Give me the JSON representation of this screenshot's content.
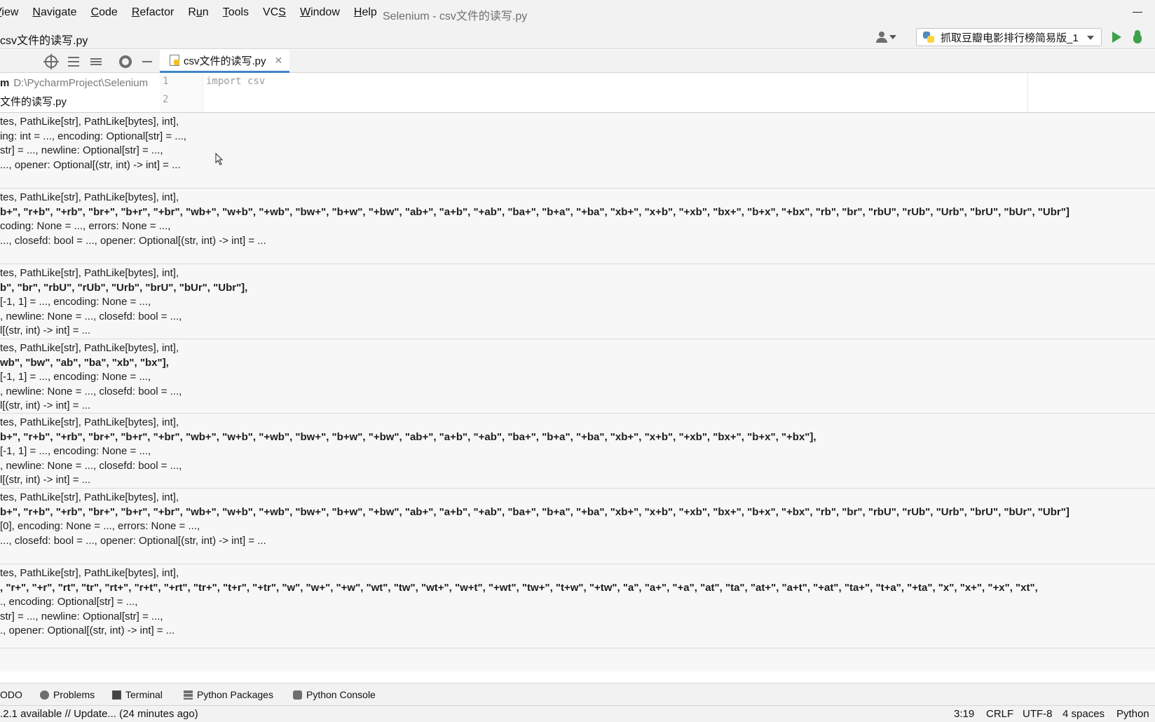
{
  "menu": {
    "items": [
      "View",
      "Navigate",
      "Code",
      "Refactor",
      "Run",
      "Tools",
      "VCS",
      "Window",
      "Help"
    ],
    "underlined": [
      "V",
      "N",
      "C",
      "R",
      "u",
      "T",
      "S",
      "W",
      "H"
    ],
    "rest": [
      "iew",
      "avigate",
      "ode",
      "efactor",
      "n",
      "ools",
      "VC",
      "indow",
      "elp"
    ]
  },
  "window_title": "Selenium - csv文件的读写.py",
  "breadcrumb": "csv文件的读写.py",
  "run_config": {
    "label": "抓取豆瓣电影排行榜简易版_1"
  },
  "editor_tab": {
    "label": "csv文件的读写.py"
  },
  "project_tree": {
    "root_name": "m",
    "root_path": "D:\\PycharmProject\\Selenium",
    "file": "文件的读写.py"
  },
  "editor": {
    "lines": [
      {
        "num": "1",
        "code": "import csv"
      },
      {
        "num": "2",
        "code": ""
      }
    ]
  },
  "param_info": {
    "blocks": [
      {
        "lines": [
          {
            "text": "tes, PathLike[str], PathLike[bytes], int],",
            "bold": false
          },
          {
            "text": "ing: int = ..., encoding: Optional[str] = ...,",
            "bold": false
          },
          {
            "text": "str] = ..., newline: Optional[str] = ...,",
            "bold": false
          },
          {
            "text": "..., opener: Optional[(str, int) -> int] = ...",
            "bold": false
          }
        ]
      },
      {
        "lines": [
          {
            "text": "tes, PathLike[str], PathLike[bytes], int],",
            "bold": false
          },
          {
            "text": "b+\", \"r+b\", \"+rb\", \"br+\", \"b+r\", \"+br\", \"wb+\", \"w+b\", \"+wb\", \"bw+\", \"b+w\", \"+bw\", \"ab+\", \"a+b\", \"+ab\", \"ba+\", \"b+a\", \"+ba\", \"xb+\", \"x+b\", \"+xb\", \"bx+\", \"b+x\", \"+bx\", \"rb\", \"br\", \"rbU\", \"rUb\", \"Urb\", \"brU\", \"bUr\", \"Ubr\"]",
            "bold": true
          },
          {
            "text": "coding: None = ..., errors: None = ...,",
            "bold": false
          },
          {
            "text": "..., closefd: bool = ..., opener: Optional[(str, int) -> int] = ...",
            "bold": false
          }
        ]
      },
      {
        "lines": [
          {
            "text": "tes, PathLike[str], PathLike[bytes], int],",
            "bold": false
          },
          {
            "text": "b\", \"br\", \"rbU\", \"rUb\", \"Urb\", \"brU\", \"bUr\", \"Ubr\"],",
            "bold": true
          },
          {
            "text": "[-1, 1] = ..., encoding: None = ...,",
            "bold": false
          },
          {
            "text": ", newline: None = ..., closefd: bool = ...,",
            "bold": false
          },
          {
            "text": "l[(str, int) -> int] = ...",
            "bold": false
          }
        ]
      },
      {
        "lines": [
          {
            "text": "tes, PathLike[str], PathLike[bytes], int],",
            "bold": false
          },
          {
            "text": "wb\", \"bw\", \"ab\", \"ba\", \"xb\", \"bx\"],",
            "bold": true
          },
          {
            "text": "[-1, 1] = ..., encoding: None = ...,",
            "bold": false
          },
          {
            "text": ", newline: None = ..., closefd: bool = ...,",
            "bold": false
          },
          {
            "text": "l[(str, int) -> int] = ...",
            "bold": false
          }
        ]
      },
      {
        "lines": [
          {
            "text": "tes, PathLike[str], PathLike[bytes], int],",
            "bold": false
          },
          {
            "text": "b+\", \"r+b\", \"+rb\", \"br+\", \"b+r\", \"+br\", \"wb+\", \"w+b\", \"+wb\", \"bw+\", \"b+w\", \"+bw\", \"ab+\", \"a+b\", \"+ab\", \"ba+\", \"b+a\", \"+ba\", \"xb+\", \"x+b\", \"+xb\", \"bx+\", \"b+x\", \"+bx\"],",
            "bold": true
          },
          {
            "text": "[-1, 1] = ..., encoding: None = ...,",
            "bold": false
          },
          {
            "text": ", newline: None = ..., closefd: bool = ...,",
            "bold": false
          },
          {
            "text": "l[(str, int) -> int] = ...",
            "bold": false
          }
        ]
      },
      {
        "lines": [
          {
            "text": "tes, PathLike[str], PathLike[bytes], int],",
            "bold": false
          },
          {
            "text": "b+\", \"r+b\", \"+rb\", \"br+\", \"b+r\", \"+br\", \"wb+\", \"w+b\", \"+wb\", \"bw+\", \"b+w\", \"+bw\", \"ab+\", \"a+b\", \"+ab\", \"ba+\", \"b+a\", \"+ba\", \"xb+\", \"x+b\", \"+xb\", \"bx+\", \"b+x\", \"+bx\", \"rb\", \"br\", \"rbU\", \"rUb\", \"Urb\", \"brU\", \"bUr\", \"Ubr\"]",
            "bold": true
          },
          {
            "text": "[0], encoding: None = ..., errors: None = ...,",
            "bold": false
          },
          {
            "text": "..., closefd: bool = ..., opener: Optional[(str, int) -> int] = ...",
            "bold": false
          }
        ]
      },
      {
        "lines": [
          {
            "text": "tes, PathLike[str], PathLike[bytes], int],",
            "bold": false
          },
          {
            "text": ", \"r+\", \"+r\", \"rt\", \"tr\", \"rt+\", \"r+t\", \"+rt\", \"tr+\", \"t+r\", \"+tr\", \"w\", \"w+\", \"+w\", \"wt\", \"tw\", \"wt+\", \"w+t\", \"+wt\", \"tw+\", \"t+w\", \"+tw\", \"a\", \"a+\", \"+a\", \"at\", \"ta\", \"at+\", \"a+t\", \"+at\", \"ta+\", \"t+a\", \"+ta\", \"x\", \"x+\", \"+x\", \"xt\", ",
            "bold": true
          },
          {
            "text": "., encoding: Optional[str] = ...,",
            "bold": false
          },
          {
            "text": "str] = ..., newline: Optional[str] = ...,",
            "bold": false
          },
          {
            "text": "., opener: Optional[(str, int) -> int] = ...",
            "bold": false
          }
        ]
      }
    ]
  },
  "tool_windows": {
    "todo": "ODO",
    "problems": "Problems",
    "terminal": "Terminal",
    "packages": "Python Packages",
    "console": "Python Console"
  },
  "status": {
    "message": ".2.1 available // Update... (24 minutes ago)",
    "position": "3:19",
    "line_sep": "CRLF",
    "encoding": "UTF-8",
    "indent": "4 spaces",
    "interpreter": "Python"
  },
  "icons": {
    "user": "user-icon",
    "run": "run-icon",
    "debug": "debug-icon",
    "locate": "locate-icon",
    "expand": "expand-all-icon",
    "collapse": "collapse-all-icon",
    "settings": "gear-icon",
    "hide": "hide-icon"
  }
}
